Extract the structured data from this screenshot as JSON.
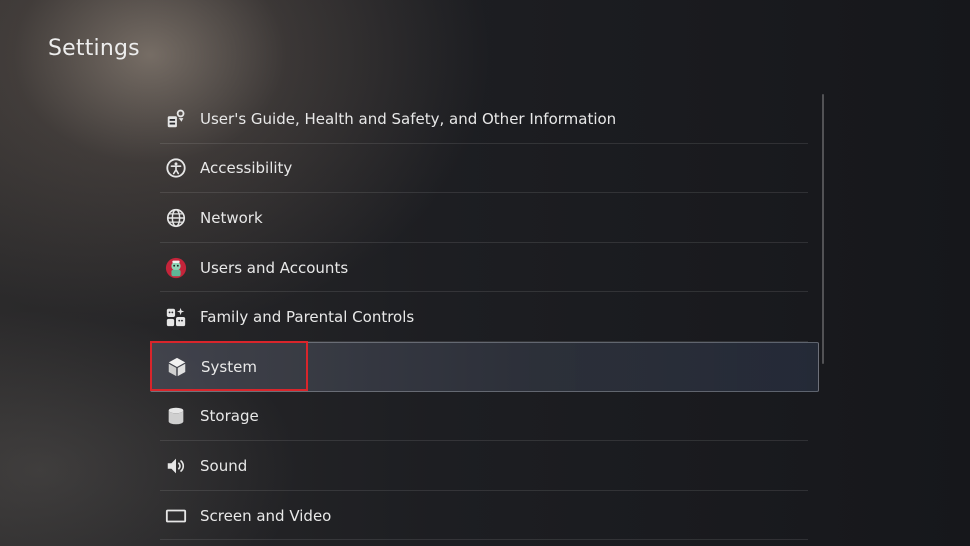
{
  "page": {
    "title": "Settings"
  },
  "menu": {
    "items": [
      {
        "label": "User's Guide, Health and Safety, and Other Information",
        "icon": "guide-icon"
      },
      {
        "label": "Accessibility",
        "icon": "accessibility-icon"
      },
      {
        "label": "Network",
        "icon": "globe-icon"
      },
      {
        "label": "Users and Accounts",
        "icon": "user-avatar-icon"
      },
      {
        "label": "Family and Parental Controls",
        "icon": "family-icon"
      },
      {
        "label": "System",
        "icon": "cube-icon",
        "selected": true
      },
      {
        "label": "Storage",
        "icon": "storage-icon"
      },
      {
        "label": "Sound",
        "icon": "speaker-icon"
      },
      {
        "label": "Screen and Video",
        "icon": "screen-icon"
      }
    ]
  },
  "colors": {
    "highlight": "#d9252b",
    "text": "#e8e8e8"
  }
}
